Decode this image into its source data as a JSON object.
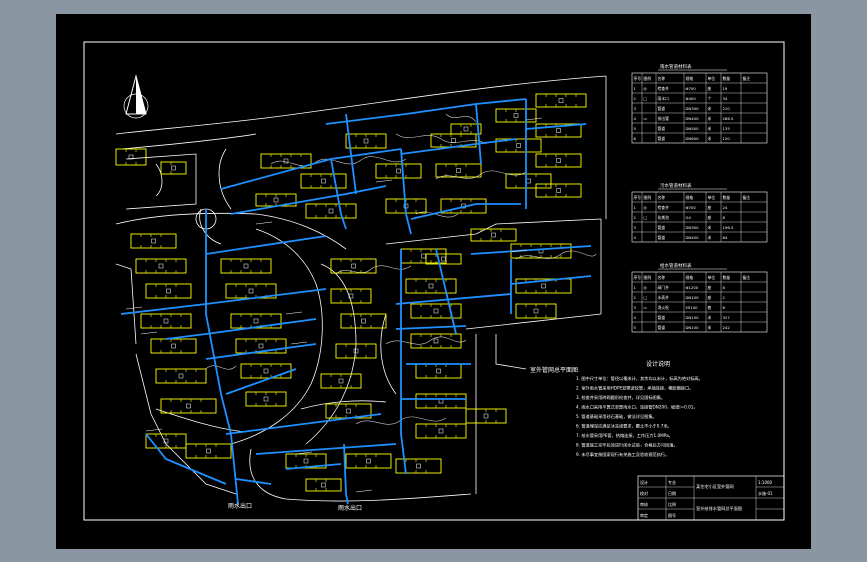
{
  "colors": {
    "background_outer": "#8b96a3",
    "sheet": "#000000",
    "border": "#ffffff",
    "pipe": "#1e90ff",
    "building": "#ffff00",
    "road": "#ffffff"
  },
  "icons": {
    "north_arrow": "north-arrow-icon"
  },
  "legend_tables": [
    {
      "title": "雨水管道材料表",
      "headers": [
        "序号",
        "图例",
        "名称",
        "规格",
        "单位",
        "数量",
        "备注"
      ],
      "rows": [
        [
          "1",
          "◎",
          "检查井",
          "Φ700",
          "座",
          "19",
          ""
        ],
        [
          "2",
          "□",
          "雨水口",
          "Φ400",
          "个",
          "34",
          ""
        ],
        [
          "3",
          "",
          "管道",
          "DN300",
          "米",
          "210",
          ""
        ],
        [
          "4",
          "▭",
          "排出管",
          "DN400",
          "米",
          "286.5",
          ""
        ],
        [
          "5",
          "",
          "管道",
          "DN500",
          "米",
          "135",
          ""
        ],
        [
          "6",
          "",
          "管道",
          "DN600",
          "米",
          "120",
          ""
        ]
      ]
    },
    {
      "title": "污水管道材料表",
      "headers": [
        "序号",
        "图例",
        "名称",
        "规格",
        "单位",
        "数量",
        "备注"
      ],
      "rows": [
        [
          "1",
          "◎",
          "检查井",
          "Φ700",
          "座",
          "24",
          ""
        ],
        [
          "2",
          "□",
          "化粪池",
          "G4",
          "座",
          "8",
          ""
        ],
        [
          "3",
          "",
          "管道",
          "DN300",
          "米",
          "196.5",
          ""
        ],
        [
          "4",
          "",
          "管道",
          "DN400",
          "米",
          "84",
          ""
        ]
      ]
    },
    {
      "title": "给水管道材料表",
      "headers": [
        "序号",
        "图例",
        "名称",
        "规格",
        "单位",
        "数量",
        "备注"
      ],
      "rows": [
        [
          "1",
          "◎",
          "阀门井",
          "Φ1200",
          "座",
          "8",
          ""
        ],
        [
          "2",
          "□",
          "水表井",
          "DN100",
          "座",
          "2",
          ""
        ],
        [
          "3",
          "▭",
          "消火栓",
          "SS100",
          "套",
          "6",
          ""
        ],
        [
          "4",
          "",
          "管道",
          "DN150",
          "米",
          "327",
          ""
        ],
        [
          "5",
          "",
          "管道",
          "DN100",
          "米",
          "242",
          ""
        ]
      ]
    }
  ],
  "notes": {
    "title": "设计说明",
    "lines": [
      "1. 图中尺寸单位：管径以毫米计，其余均以米计，标高为绝对标高。",
      "2. 室外雨水管采用HDPE双壁波纹管，承插连接，橡胶圈接口。",
      "3. 检查井采用砖砌圆形检查井，详见国标图集。",
      "4. 雨水口采用平箅式单箅雨水口，连接管DN200，坡度i=0.01。",
      "5. 管道基础采用砂石基础，做法详见图集。",
      "6. 管道埋深应满足冰冻线要求，覆土不小于0.7米。",
      "7. 给水管采用PE管，热熔连接，工作压力1.0MPa。",
      "8. 管道施工完毕后须进行闭水试验，合格后方可回填。",
      "9. 未尽事宜按国家现行有关施工及验收规范执行。"
    ]
  },
  "map_label": "室外管网总平面图",
  "outlet_labels": [
    "雨水出口",
    "雨水出口"
  ],
  "title_block": {
    "left_cells": [
      "设计",
      "校对",
      "审核",
      "审定"
    ],
    "mid_cells": [
      "专业",
      "日期",
      "比例",
      "图号"
    ],
    "project": "某住宅小区室外管网",
    "drawing": "室外给排水管网总平面图",
    "right_cells": [
      "1:1000",
      "水施-01",
      "",
      ""
    ]
  }
}
